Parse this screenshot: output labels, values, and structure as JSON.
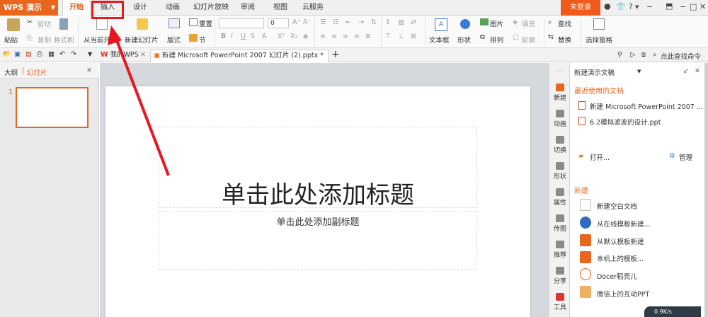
{
  "app": {
    "title": "WPS 演示",
    "login_label": "未登录"
  },
  "menu_tabs": [
    "开始",
    "插入",
    "设计",
    "动画",
    "幻灯片放映",
    "审阅",
    "视图",
    "云服务"
  ],
  "ribbon": {
    "paste": "粘贴",
    "cut": "剪切",
    "copy": "复制",
    "format_painter": "格式刷",
    "from_current": "从当前开始",
    "new_slide": "新建幻灯片",
    "layout": "版式",
    "section": "节",
    "reset": "重置",
    "font_size": "0",
    "text_box": "文本框",
    "shape": "形状",
    "picture": "图片",
    "fill": "填充",
    "arrange": "排列",
    "outline": "轮廓",
    "find": "查找",
    "replace": "替换",
    "select_pane": "选择窗格"
  },
  "doc_tabs": {
    "home": "我的WPS",
    "doc": "新建 Microsoft PowerPoint 2007 幻灯片 (2).pptx *",
    "search": "点此查找命令"
  },
  "left_pane": {
    "outline_tab": "大纲",
    "slides_tab": "幻灯片",
    "slide_number": "1"
  },
  "slide": {
    "title": "单击此处添加标题",
    "subtitle": "单击此处添加副标题"
  },
  "icon_column": [
    "新建",
    "动画",
    "切换",
    "形状",
    "属性",
    "传图",
    "推荐",
    "分享",
    "工具"
  ],
  "task_pane": {
    "header": "新建演示文稿",
    "recent_heading": "最近使用的文档",
    "recent": [
      "新建 Microsoft PowerPoint 2007 ...",
      "6.2模拟滤波的设计.ppt"
    ],
    "open": "打开...",
    "manage": "管理",
    "new_heading": "新建",
    "new_items": [
      "新建空白文档",
      "从在线模板新建...",
      "从默认模板新建",
      "本机上的模板...",
      "Docer稻壳儿",
      "微信上的互动PPT"
    ]
  },
  "status": {
    "speed": "0.9K/s"
  }
}
